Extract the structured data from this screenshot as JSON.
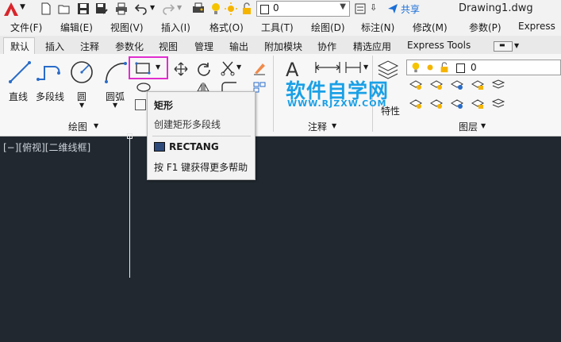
{
  "titlebar": {
    "layer_value": "0",
    "share_label": "共享",
    "document_title": "Drawing1.dwg"
  },
  "menu": [
    "文件(F)",
    "编辑(E)",
    "视图(V)",
    "插入(I)",
    "格式(O)",
    "工具(T)",
    "绘图(D)",
    "标注(N)",
    "修改(M)",
    "参数(P)",
    "Express"
  ],
  "tabs": [
    "默认",
    "插入",
    "注释",
    "参数化",
    "视图",
    "管理",
    "输出",
    "附加模块",
    "协作",
    "精选应用",
    "Express Tools"
  ],
  "ribbon": {
    "draw_tools": {
      "line": "直线",
      "polyline": "多段线",
      "circle": "圆",
      "arc": "圆弧"
    },
    "panel_labels": {
      "draw": "绘图",
      "annotation": "注释",
      "layers": "图层"
    },
    "layer_value": "0",
    "partial_label": "特性"
  },
  "viewport": {
    "label": "[−][俯视][二维线框]"
  },
  "tooltip": {
    "title": "矩形",
    "description": "创建矩形多段线",
    "command": "RECTANG",
    "help": "按 F1 键获得更多帮助"
  },
  "watermark": {
    "title": "软件自学网",
    "url": "WWW.RJZXW.COM"
  },
  "colors": {
    "accent": "#1a6fd8",
    "highlight": "#e02dcf",
    "canvas": "#212830",
    "watermark": "#1aa0e6"
  }
}
